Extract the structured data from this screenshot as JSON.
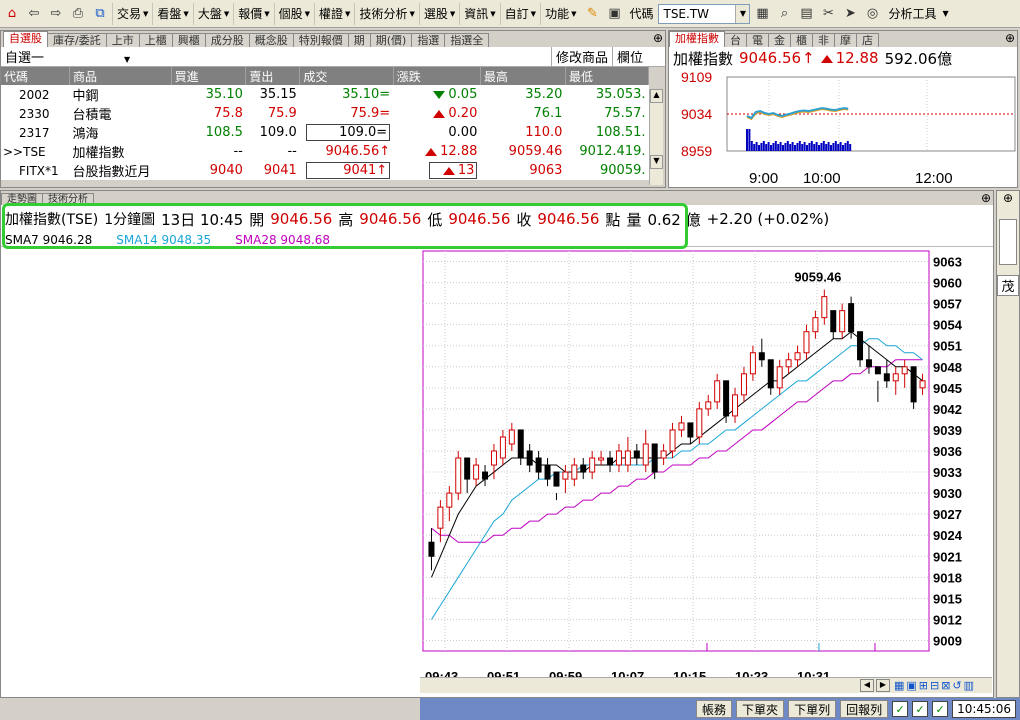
{
  "toolbar": {
    "menus": [
      "交易",
      "看盤",
      "大盤",
      "報價",
      "個股",
      "權證",
      "技術分析",
      "選股",
      "資訊",
      "自訂",
      "功能"
    ],
    "code_label": "代碼",
    "code_value": "TSE.TW",
    "analysis_tools": "分析工具"
  },
  "watchlist": {
    "tabs": [
      "自選股",
      "庫存/委託",
      "上市",
      "上櫃",
      "興櫃",
      "成分股",
      "概念股",
      "特別報價",
      "期",
      "期(價)",
      "指選",
      "指選全"
    ],
    "group": "自選一",
    "modify_btn": "修改商品",
    "column_btn": "欄位",
    "headers": [
      "代碼",
      "商品",
      "買進",
      "賣出",
      "成交",
      "漲跌",
      "最高",
      "最低"
    ],
    "rows": [
      {
        "code": "2002",
        "name": "中鋼",
        "bid": "35.10",
        "ask": "35.15",
        "last": "35.10=",
        "chg": "0.05",
        "high": "35.20",
        "low": "35.053."
      },
      {
        "code": "2330",
        "name": "台積電",
        "bid": "75.8",
        "ask": "75.9",
        "last": "75.9=",
        "chg": "0.20",
        "high": "76.1",
        "low": "75.57."
      },
      {
        "code": "2317",
        "name": "鴻海",
        "bid": "108.5",
        "ask": "109.0",
        "last": "109.0=",
        "chg": "0.00",
        "high": "110.0",
        "low": "108.51."
      },
      {
        "code": ">>TSE",
        "name": "加權指數",
        "bid": "--",
        "ask": "--",
        "last": "9046.56",
        "chg": "12.88",
        "high": "9059.46",
        "low": "9012.419."
      },
      {
        "code": "FITX*1",
        "name": "台股指數近月",
        "bid": "9040",
        "ask": "9041",
        "last": "9041",
        "chg": "13",
        "high": "9063",
        "low": "90059."
      }
    ]
  },
  "mini": {
    "tabs": [
      "加權指數",
      "台",
      "電",
      "金",
      "櫃",
      "非",
      "摩",
      "店"
    ],
    "title": "加權指數",
    "value": "9046.56",
    "change": "12.88",
    "volume": "592.06億",
    "y_ticks": [
      "9109",
      "9034",
      "8959"
    ],
    "x_ticks": [
      "9:00",
      "10:00",
      "12:00"
    ]
  },
  "chart_tabs": [
    "走勢圖",
    "技術分析"
  ],
  "info": {
    "name": "加權指數(TSE)",
    "period": "1分鐘圖",
    "date_time": "13日 10:45",
    "open_label": "開",
    "open": "9046.56",
    "high_label": "高",
    "high": "9046.56",
    "low_label": "低",
    "low": "9046.56",
    "close_label": "收",
    "close": "9046.56",
    "pts_label": "點",
    "vol_label": "量",
    "vol": "0.62 億",
    "chg": "+2.20 (+0.02%)"
  },
  "sma": [
    {
      "label": "SMA7 9046.28",
      "color": "#000000"
    },
    {
      "label": "SMA14 9048.35",
      "color": "#1aa6d6"
    },
    {
      "label": "SMA28 9048.68",
      "color": "#c000c0"
    }
  ],
  "chart_data": {
    "type": "candlestick",
    "y_ticks": [
      9063,
      9060,
      9057,
      9054,
      9051,
      9048,
      9045,
      9042,
      9039,
      9036,
      9033,
      9030,
      9027,
      9024,
      9021,
      9018,
      9015,
      9012,
      9009
    ],
    "x_ticks": [
      "09:43",
      "09:51",
      "09:59",
      "10:07",
      "10:15",
      "10:23",
      "10:31"
    ],
    "ylim": [
      9007.5,
      9064.5
    ],
    "peak_label": "9059.46",
    "candles": [
      [
        9023,
        9025,
        9019,
        9021
      ],
      [
        9025,
        9029,
        9023,
        9028
      ],
      [
        9028,
        9031,
        9026,
        9030
      ],
      [
        9030,
        9036,
        9029,
        9035
      ],
      [
        9035,
        9034,
        9030,
        9032
      ],
      [
        9032,
        9035,
        9031,
        9034
      ],
      [
        9033,
        9034,
        9031,
        9032
      ],
      [
        9034,
        9037,
        9032,
        9036
      ],
      [
        9035,
        9039,
        9034,
        9038
      ],
      [
        9037,
        9040,
        9036,
        9039
      ],
      [
        9039,
        9036,
        9034,
        9035
      ],
      [
        9036,
        9037,
        9033,
        9034
      ],
      [
        9035,
        9036,
        9032,
        9033
      ],
      [
        9034,
        9035,
        9031,
        9032
      ],
      [
        9033,
        9030,
        9029,
        9031
      ],
      [
        9032,
        9034,
        9030,
        9033
      ],
      [
        9032,
        9035,
        9031,
        9034
      ],
      [
        9034,
        9035,
        9032,
        9033
      ],
      [
        9033,
        9036,
        9032,
        9035
      ],
      [
        9035,
        9036,
        9034,
        9035
      ],
      [
        9035,
        9036,
        9033,
        9034
      ],
      [
        9034,
        9037,
        9033,
        9036
      ],
      [
        9034,
        9038,
        9033,
        9036
      ],
      [
        9036,
        9037,
        9034,
        9035
      ],
      [
        9034,
        9039,
        9033,
        9037
      ],
      [
        9037,
        9035,
        9032,
        9033
      ],
      [
        9035,
        9037,
        9034,
        9036
      ],
      [
        9036,
        9040,
        9035,
        9039
      ],
      [
        9039,
        9041,
        9038,
        9040
      ],
      [
        9040,
        9039,
        9037,
        9038
      ],
      [
        9038,
        9043,
        9037,
        9042
      ],
      [
        9042,
        9044,
        9041,
        9043
      ],
      [
        9043,
        9047,
        9042,
        9046
      ],
      [
        9046,
        9045,
        9040,
        9041
      ],
      [
        9041,
        9045,
        9040,
        9044
      ],
      [
        9044,
        9048,
        9043,
        9047
      ],
      [
        9047,
        9051,
        9046,
        9050
      ],
      [
        9050,
        9052,
        9048,
        9049
      ],
      [
        9049,
        9047,
        9044,
        9045
      ],
      [
        9045,
        9049,
        9044,
        9048
      ],
      [
        9048,
        9050,
        9047,
        9049
      ],
      [
        9049,
        9051,
        9048,
        9050
      ],
      [
        9050,
        9054,
        9049,
        9053
      ],
      [
        9053,
        9056,
        9052,
        9055
      ],
      [
        9055,
        9059,
        9054,
        9058
      ],
      [
        9056,
        9055,
        9052,
        9053
      ],
      [
        9053,
        9057,
        9052,
        9056
      ],
      [
        9057,
        9058,
        9052,
        9053
      ],
      [
        9053,
        9052,
        9048,
        9049
      ],
      [
        9049,
        9051,
        9047,
        9048
      ],
      [
        9048,
        9046,
        9043,
        9047
      ],
      [
        9047,
        9049,
        9045,
        9046
      ],
      [
        9046,
        9048,
        9044,
        9047
      ],
      [
        9047,
        9049,
        9045,
        9048
      ],
      [
        9048,
        9045,
        9042,
        9043
      ],
      [
        9045,
        9047,
        9044,
        9046
      ]
    ],
    "sma7": [
      9018,
      9021,
      9024,
      9027,
      9029,
      9031,
      9032,
      9033,
      9034,
      9035,
      9035,
      9035,
      9034,
      9034,
      9034,
      9033,
      9033,
      9033,
      9034,
      9034,
      9034,
      9035,
      9035,
      9035,
      9035,
      9035,
      9035,
      9036,
      9037,
      9037,
      9038,
      9039,
      9040,
      9041,
      9042,
      9043,
      9044,
      9045,
      9046,
      9046,
      9047,
      9048,
      9049,
      9050,
      9051,
      9052,
      9052,
      9053,
      9052,
      9051,
      9050,
      9049,
      9048,
      9048,
      9047,
      9046
    ],
    "sma14": [
      9012,
      9014,
      9016,
      9018,
      9020,
      9022,
      9024,
      9026,
      9027,
      9029,
      9030,
      9031,
      9032,
      9032,
      9033,
      9033,
      9033,
      9034,
      9034,
      9034,
      9034,
      9034,
      9034,
      9034,
      9034,
      9035,
      9035,
      9035,
      9036,
      9036,
      9037,
      9037,
      9038,
      9039,
      9039,
      9040,
      9041,
      9042,
      9043,
      9044,
      9045,
      9046,
      9046,
      9047,
      9048,
      9049,
      9050,
      9051,
      9051,
      9052,
      9052,
      9051,
      9051,
      9050,
      9050,
      9049
    ],
    "sma28": [
      9025,
      9024,
      9024,
      9023,
      9023,
      9023,
      9023,
      9024,
      9024,
      9025,
      9025,
      9026,
      9026,
      9027,
      9027,
      9028,
      9028,
      9029,
      9029,
      9030,
      9030,
      9031,
      9031,
      9032,
      9032,
      9033,
      9033,
      9034,
      9034,
      9034,
      9035,
      9035,
      9036,
      9036,
      9037,
      9038,
      9039,
      9039,
      9040,
      9041,
      9042,
      9043,
      9043,
      9044,
      9045,
      9046,
      9046,
      9047,
      9047,
      9048,
      9048,
      9048,
      9049,
      9049,
      9049,
      9049
    ]
  },
  "side_label": "茂",
  "status": {
    "buttons": [
      "帳務",
      "下單夾",
      "下單列",
      "回報列"
    ],
    "time": "10:45:06"
  }
}
